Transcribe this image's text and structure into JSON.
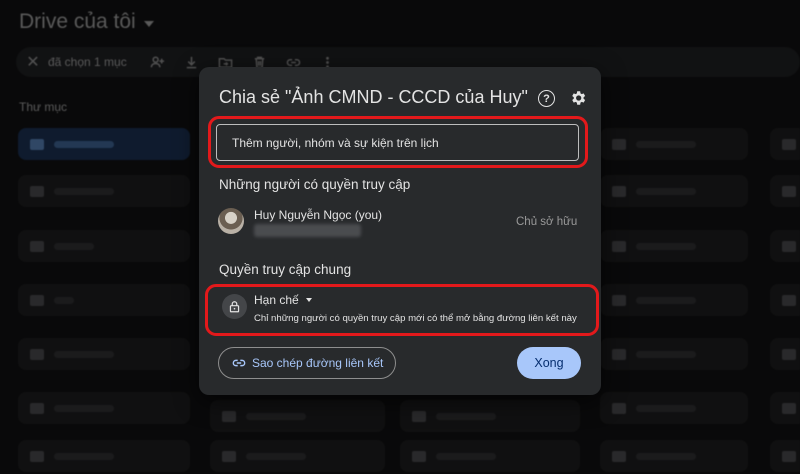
{
  "drive": {
    "title": "Drive của tôi",
    "selection_count": "đã chọn 1 mục",
    "section_label": "Thư mục"
  },
  "dialog": {
    "title": "Chia sẻ \"Ảnh CMND - CCCD của Huy\"",
    "add_placeholder": "Thêm người, nhóm và sự kiện trên lịch",
    "people_heading": "Những người có quyền truy cập",
    "person": {
      "name": "Huy Nguyễn Ngọc (you)",
      "role": "Chủ sở hữu"
    },
    "general_heading": "Quyền truy cập chung",
    "access": {
      "level": "Hạn chế",
      "description": "Chỉ những người có quyền truy cập mới có thể mở bằng đường liên kết này"
    },
    "copy_link_label": "Sao chép đường liên kết",
    "done_label": "Xong"
  },
  "colors": {
    "accent": "#a8c7fa",
    "highlight_border": "#e3191b"
  },
  "icons": [
    "close-icon",
    "add-person-icon",
    "download-icon",
    "move-icon",
    "trash-icon",
    "link-icon",
    "more-vert-icon",
    "help-icon",
    "gear-icon",
    "lock-icon"
  ]
}
